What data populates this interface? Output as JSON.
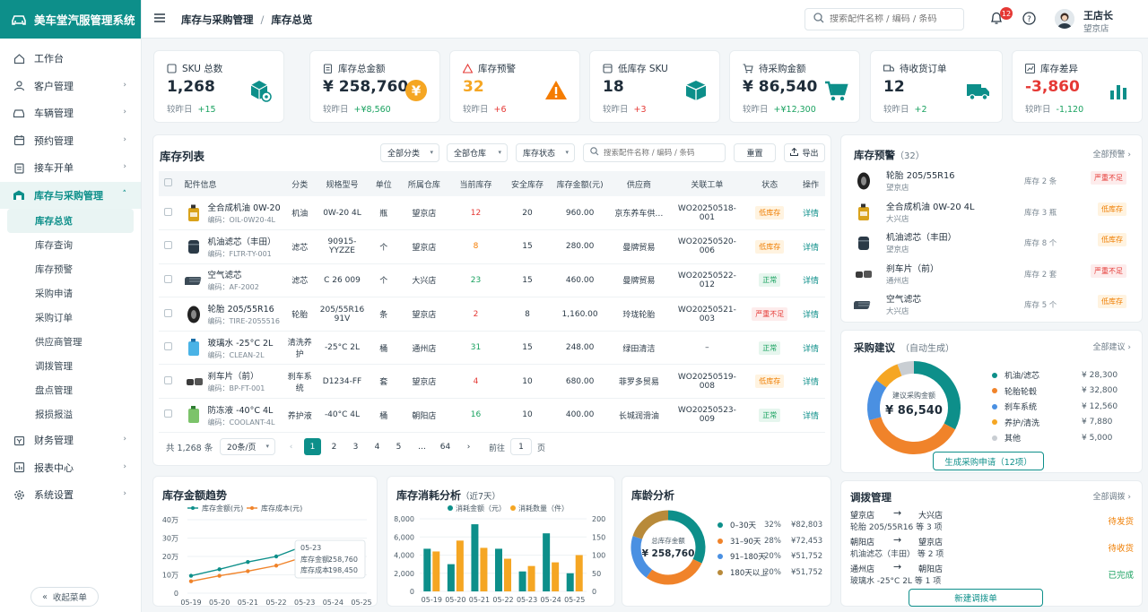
{
  "app": {
    "title": "美车堂汽服管理系统"
  },
  "sidebar": {
    "items": [
      {
        "label": "工作台"
      },
      {
        "label": "客户管理"
      },
      {
        "label": "车辆管理"
      },
      {
        "label": "预约管理"
      },
      {
        "label": "接车开单"
      },
      {
        "label": "库存与采购管理"
      },
      {
        "label": "财务管理"
      },
      {
        "label": "报表中心"
      },
      {
        "label": "系统设置"
      }
    ],
    "sub_items": [
      "库存总览",
      "库存查询",
      "库存预警",
      "采购申请",
      "采购订单",
      "供应商管理",
      "调拨管理",
      "盘点管理",
      "报损报溢"
    ],
    "collapse_label": "收起菜单"
  },
  "header": {
    "breadcrumb": [
      "库存与采购管理",
      "库存总览"
    ],
    "search_placeholder": "搜索配件名称 / 编码 / 条码",
    "notification_count": "12",
    "user_name": "王店长",
    "user_store": "望京店"
  },
  "kpis": [
    {
      "title": "SKU 总数",
      "value": "1,268",
      "compare_label": "较昨日",
      "delta": "+15",
      "icon": "cube-settings-icon",
      "color": "#0d8f8a"
    },
    {
      "title": "库存总金额",
      "value": "¥ 258,760",
      "compare_label": "较昨日",
      "delta": "+¥8,560",
      "icon": "yen-coin-icon",
      "color": "#f5a623"
    },
    {
      "title": "库存预警",
      "value": "32",
      "compare_label": "较昨日",
      "delta": "+6",
      "icon": "warning-icon",
      "color": "#f57c00"
    },
    {
      "title": "低库存 SKU",
      "value": "18",
      "compare_label": "较昨日",
      "delta": "+3",
      "icon": "box-icon",
      "color": "#0d8f8a"
    },
    {
      "title": "待采购金额",
      "value": "¥ 86,540",
      "compare_label": "较昨日",
      "delta": "+¥12,300",
      "icon": "cart-icon",
      "color": "#0d8f8a"
    },
    {
      "title": "待收货订单",
      "value": "12",
      "compare_label": "较昨日",
      "delta": "+2",
      "icon": "truck-icon",
      "color": "#0d8f8a"
    },
    {
      "title": "库存差异",
      "value": "-3,860",
      "compare_label": "较昨日",
      "delta": "-1,120",
      "icon": "bar-chart-icon",
      "color": "#0d8f8a"
    }
  ],
  "inventory": {
    "title": "库存列表",
    "filters": [
      "全部分类",
      "全部仓库",
      "库存状态"
    ],
    "search_placeholder": "搜索配件名称 / 编码 / 条码",
    "reset_label": "重置",
    "export_label": "导出",
    "columns": [
      "配件信息",
      "分类",
      "规格型号",
      "单位",
      "所属仓库",
      "当前库存",
      "安全库存",
      "库存金额(元)",
      "供应商",
      "关联工单",
      "状态",
      "操作"
    ],
    "rows": [
      {
        "name": "全合成机油 0W-20",
        "code": "编码：OIL-0W20-4L",
        "category": "机油",
        "spec": "0W-20 4L",
        "unit": "瓶",
        "warehouse": "望京店",
        "stock": "12",
        "safety": "20",
        "amount": "960.00",
        "supplier": "京东养车供…",
        "order": "WO20250518-001",
        "status": "低库存",
        "action": "详情"
      },
      {
        "name": "机油滤芯（丰田）",
        "code": "编码：FLTR-TY-001",
        "category": "滤芯",
        "spec": "90915-YYZZE",
        "unit": "个",
        "warehouse": "望京店",
        "stock": "8",
        "safety": "15",
        "amount": "280.00",
        "supplier": "曼牌贸易",
        "order": "WO20250520-006",
        "status": "低库存",
        "action": "详情"
      },
      {
        "name": "空气滤芯",
        "code": "编码：AF-2002",
        "category": "滤芯",
        "spec": "C 26 009",
        "unit": "个",
        "warehouse": "大兴店",
        "stock": "23",
        "safety": "15",
        "amount": "460.00",
        "supplier": "曼牌贸易",
        "order": "WO20250522-012",
        "status": "正常",
        "action": "详情"
      },
      {
        "name": "轮胎 205/55R16",
        "code": "编码：TIRE-2055516",
        "category": "轮胎",
        "spec": "205/55R16 91V",
        "unit": "条",
        "warehouse": "望京店",
        "stock": "2",
        "safety": "8",
        "amount": "1,160.00",
        "supplier": "玲珑轮胎",
        "order": "WO20250521-003",
        "status": "严重不足",
        "action": "详情"
      },
      {
        "name": "玻璃水 -25°C 2L",
        "code": "编码：CLEAN-2L",
        "category": "清洗养护",
        "spec": "-25°C 2L",
        "unit": "桶",
        "warehouse": "通州店",
        "stock": "31",
        "safety": "15",
        "amount": "248.00",
        "supplier": "绿田清洁",
        "order": "–",
        "status": "正常",
        "action": "详情"
      },
      {
        "name": "刹车片（前）",
        "code": "编码：BP-FT-001",
        "category": "刹车系统",
        "spec": "D1234-FF",
        "unit": "套",
        "warehouse": "望京店",
        "stock": "4",
        "safety": "10",
        "amount": "680.00",
        "supplier": "菲罗多贸易",
        "order": "WO20250519-008",
        "status": "低库存",
        "action": "详情"
      },
      {
        "name": "防冻液 -40°C 4L",
        "code": "编码：COOLANT-4L",
        "category": "养护液",
        "spec": "-40°C 4L",
        "unit": "桶",
        "warehouse": "朝阳店",
        "stock": "16",
        "safety": "10",
        "amount": "400.00",
        "supplier": "长城润滑油",
        "order": "WO20250523-009",
        "status": "正常",
        "action": "详情"
      }
    ],
    "pagination": {
      "total": "共 1,268 条",
      "page_size": "20条/页",
      "pages": [
        "1",
        "2",
        "3",
        "4",
        "5",
        "…",
        "64"
      ],
      "goto_label": "前往",
      "goto_value": "1",
      "page_suffix": "页"
    }
  },
  "warnings": {
    "title": "库存预警",
    "count": "（32）",
    "more": "全部预警",
    "items": [
      {
        "name": "轮胎 205/55R16",
        "store": "望京店",
        "qty": "库存 2 条",
        "status": "严重不足"
      },
      {
        "name": "全合成机油 0W-20 4L",
        "store": "大兴店",
        "qty": "库存 3 瓶",
        "status": "低库存"
      },
      {
        "name": "机油滤芯（丰田）",
        "store": "望京店",
        "qty": "库存 8 个",
        "status": "低库存"
      },
      {
        "name": "刹车片（前）",
        "store": "通州店",
        "qty": "库存 2 套",
        "status": "严重不足"
      },
      {
        "name": "空气滤芯",
        "store": "大兴店",
        "qty": "库存 5 个",
        "status": "低库存"
      }
    ]
  },
  "purchase": {
    "title": "采购建议",
    "subtitle": "（自动生成）",
    "more": "全部建议",
    "center_label": "建议采购金额",
    "center_value": "¥ 86,540",
    "button": "生成采购申请（12项）"
  },
  "transfer": {
    "title": "调拨管理",
    "more": "全部调拨",
    "items": [
      {
        "from": "望京店",
        "to": "大兴店",
        "desc": "轮胎 205/55R16 等 3 项",
        "status": "待发货",
        "color": "#ef7d00"
      },
      {
        "from": "朝阳店",
        "to": "望京店",
        "desc": "机油滤芯（丰田） 等 2 项",
        "status": "待收货",
        "color": "#ef7d00"
      },
      {
        "from": "通州店",
        "to": "朝阳店",
        "desc": "玻璃水 -25°C 2L 等 1 项",
        "status": "已完成",
        "color": "#1aa260"
      }
    ],
    "button": "新建调拨单"
  },
  "chart_data": [
    {
      "id": "purchase-suggest",
      "type": "pie",
      "categories": [
        "机油/滤芯",
        "轮胎轮毂",
        "刹车系统",
        "养护/清洗",
        "其他"
      ],
      "values": [
        28300,
        32800,
        12560,
        7880,
        5000
      ],
      "labels": [
        "¥ 28,300",
        "¥ 32,800",
        "¥ 12,560",
        "¥ 7,880",
        "¥ 5,000"
      ],
      "colors": [
        "#0d8f8a",
        "#f0832a",
        "#4a90e2",
        "#f5a623",
        "#c9ced3"
      ]
    },
    {
      "id": "amount-trend",
      "type": "line",
      "title": "库存金额趋势",
      "x": [
        "05-19",
        "05-20",
        "05-21",
        "05-22",
        "05-23",
        "05-24",
        "05-25"
      ],
      "series": [
        {
          "name": "库存金额(元)",
          "values": [
            95000,
            130000,
            170000,
            200000,
            258760,
            250000,
            260000
          ],
          "color": "#0d8f8a"
        },
        {
          "name": "库存成本(元)",
          "values": [
            65000,
            95000,
            120000,
            150000,
            198450,
            null,
            null
          ],
          "color": "#f0832a"
        }
      ],
      "yticks": [
        "0",
        "10万",
        "20万",
        "30万",
        "40万"
      ],
      "ylim": [
        0,
        400000
      ],
      "tooltip": {
        "date": "05-23",
        "amount_label": "库存金额：",
        "amount": "258,760",
        "cost_label": "库存成本：",
        "cost": "198,450"
      }
    },
    {
      "id": "consumption",
      "type": "bar",
      "title": "库存消耗分析",
      "subtitle": "（近7天）",
      "x": [
        "05-19",
        "05-20",
        "05-21",
        "05-22",
        "05-23",
        "05-24",
        "05-25"
      ],
      "series": [
        {
          "name": "消耗金额（元）",
          "values": [
            4700,
            3000,
            7400,
            4700,
            2200,
            6400,
            2000
          ],
          "color": "#0d8f8a"
        },
        {
          "name": "消耗数量（件）",
          "values": [
            110,
            140,
            120,
            90,
            70,
            80,
            100
          ],
          "color": "#f5a623"
        }
      ],
      "yticks_left": [
        "0",
        "2,000",
        "4,000",
        "6,000",
        "8,000"
      ],
      "yticks_right": [
        "0",
        "50",
        "100",
        "150",
        "200"
      ],
      "ylim_left": [
        0,
        8000
      ],
      "ylim_right": [
        0,
        200
      ]
    },
    {
      "id": "age-analysis",
      "type": "pie",
      "title": "库龄分析",
      "center_label": "总库存金额",
      "center_value": "¥ 258,760",
      "categories": [
        "0–30天",
        "31–90天",
        "91–180天",
        "180天以上"
      ],
      "percent": [
        32,
        28,
        20,
        20
      ],
      "percent_labels": [
        "32%",
        "28%",
        "20%",
        "20%"
      ],
      "amounts": [
        "¥82,803",
        "¥72,453",
        "¥51,752",
        "¥51,752"
      ],
      "colors": [
        "#0d8f8a",
        "#f0832a",
        "#4a90e2",
        "#b88a3a"
      ]
    }
  ]
}
